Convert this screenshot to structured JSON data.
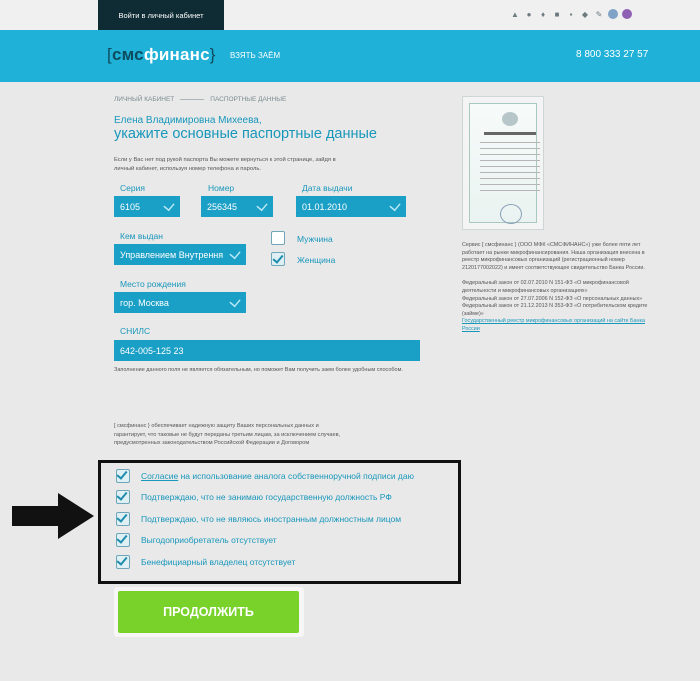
{
  "topbar": {
    "login_label": "Войти в личный кабинет",
    "social_icons": [
      "android-icon",
      "apple-icon",
      "vk-icon",
      "b-icon",
      "facebook-icon",
      "twitter-icon",
      "tool-icon",
      "browser-icon",
      "music-icon"
    ]
  },
  "header": {
    "logo_left_bracket": "[",
    "logo_sms": "смс",
    "logo_finans": "финанс",
    "logo_right_bracket": "}",
    "nav_loan": "ВЗЯТЬ ЗАЁМ",
    "phone": "8 800 333 27 57"
  },
  "breadcrumb": {
    "item1": "ЛИЧНЫЙ КАБИНЕТ",
    "item2": "ПАСПОРТНЫЕ ДАННЫЕ"
  },
  "form": {
    "user_name": "Елена Владимировна Михеева,",
    "heading": "укажите основные паспортные данные",
    "hint": "Если у Вас нет под рукой паспорта Вы можете вернуться к этой странице, зайдя в личный кабинет, используя номер телефона и пароль.",
    "series_label": "Серия",
    "series_value": "6105",
    "number_label": "Номер",
    "number_value": "256345",
    "issue_date_label": "Дата выдачи",
    "issue_date_value": "01.01.2010",
    "issued_by_label": "Кем выдан",
    "issued_by_value": "Управлением Внутрення",
    "male_label": "Мужчина",
    "female_label": "Женщина",
    "birthplace_label": "Место рождения",
    "birthplace_value": "гор. Москва",
    "snils_label": "СНИЛС",
    "snils_value": "642-005-125 23",
    "snils_note": "Заполнение данного поля не является обязательным, но поможет Вам получить заем более удобным способом."
  },
  "info": {
    "para1": "Сервис [ смсфинанс } (ООО МФК «СМСФИНАНС») уже более пяти лет работает на рынке микрофинансирования. Наша организация внесена в реестр микрофинансовых организаций (регистрационный номер 2120177002022) и имеет соответствующее свидетельство Банка России.",
    "law1": "Федеральный закон от 02.07.2010 N 151-ФЗ «О микрофинансовой деятельности и микрофинансовых организациях»",
    "law2": "Федеральный закон от 27.07.2006 N 152-ФЗ «О персональных данных»",
    "law3": "Федеральный закон от 21.12.2013 N 353-ФЗ «О потребительском кредите (займе)»",
    "registry_link": "Государственный реестр микрофинансовых организаций на сайте Банка России"
  },
  "privacy": "[ смсфинанс } обеспечивает надежную защиту Ваших персональных данных и гарантирует, что таковые не будут переданы третьим лицам, за исключением случаев, предусмотренных законодательством Российской Федерации и Договором",
  "consents": {
    "c1_link": "Согласие",
    "c1_rest": " на использование аналога собственноручной подписи даю",
    "c2": "Подтверждаю, что не занимаю государственную должность РФ",
    "c3": "Подтверждаю, что не являюсь иностранным должностным лицом",
    "c4": "Выгодоприобретатель отсутствует",
    "c5": "Бенефициарный владелец отсутствует"
  },
  "continue_label": "ПРОДОЛЖИТЬ",
  "colors": {
    "accent": "#1fb1d7",
    "field": "#1a9fc6",
    "button": "#79d22a",
    "dark": "#0f2b33"
  }
}
